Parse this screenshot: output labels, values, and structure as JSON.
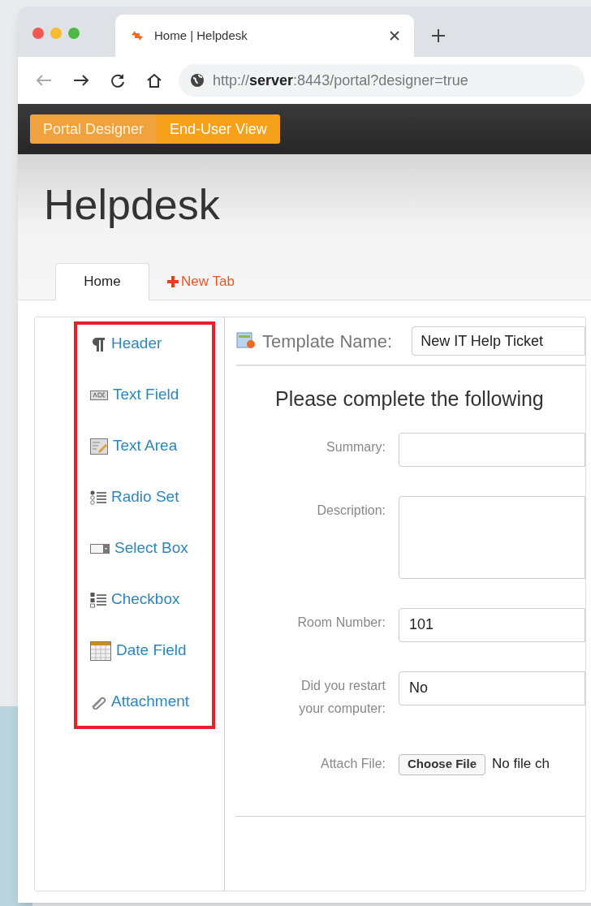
{
  "browser": {
    "tab_title": "Home | Helpdesk",
    "url_prefix": "http://",
    "url_host": "server",
    "url_rest": ":8443/portal?designer=true"
  },
  "mode_toggle": [
    {
      "label": "Portal Designer",
      "selected": true
    },
    {
      "label": "End-User View",
      "selected": false
    }
  ],
  "site_title": "Helpdesk",
  "page_tabs": [
    {
      "label": "Home",
      "kind": "tab",
      "selected": true
    },
    {
      "label": "New Tab",
      "kind": "add",
      "selected": false
    }
  ],
  "palette": [
    {
      "label": "Header",
      "kind": "header"
    },
    {
      "label": "Text Field",
      "kind": "textfield"
    },
    {
      "label": "Text Area",
      "kind": "textarea"
    },
    {
      "label": "Radio Set",
      "kind": "radio"
    },
    {
      "label": "Select Box",
      "kind": "select"
    },
    {
      "label": "Checkbox",
      "kind": "checkbox"
    },
    {
      "label": "Date Field",
      "kind": "date"
    },
    {
      "label": "Attachment",
      "kind": "attachment"
    }
  ],
  "template": {
    "label": "Template Name:",
    "value": "New IT Help Ticket"
  },
  "form": {
    "heading": "Please complete the following",
    "fields": [
      {
        "label": "Summary:",
        "kind": "text"
      },
      {
        "label": "Description:",
        "kind": "textarea"
      },
      {
        "label": "Room Number:",
        "kind": "text",
        "value": "101"
      },
      {
        "label": "Did you restart your computer:",
        "kind": "text",
        "value": "No"
      },
      {
        "label": "Attach File:",
        "kind": "file",
        "button": "Choose File",
        "value": "No file ch"
      }
    ]
  }
}
